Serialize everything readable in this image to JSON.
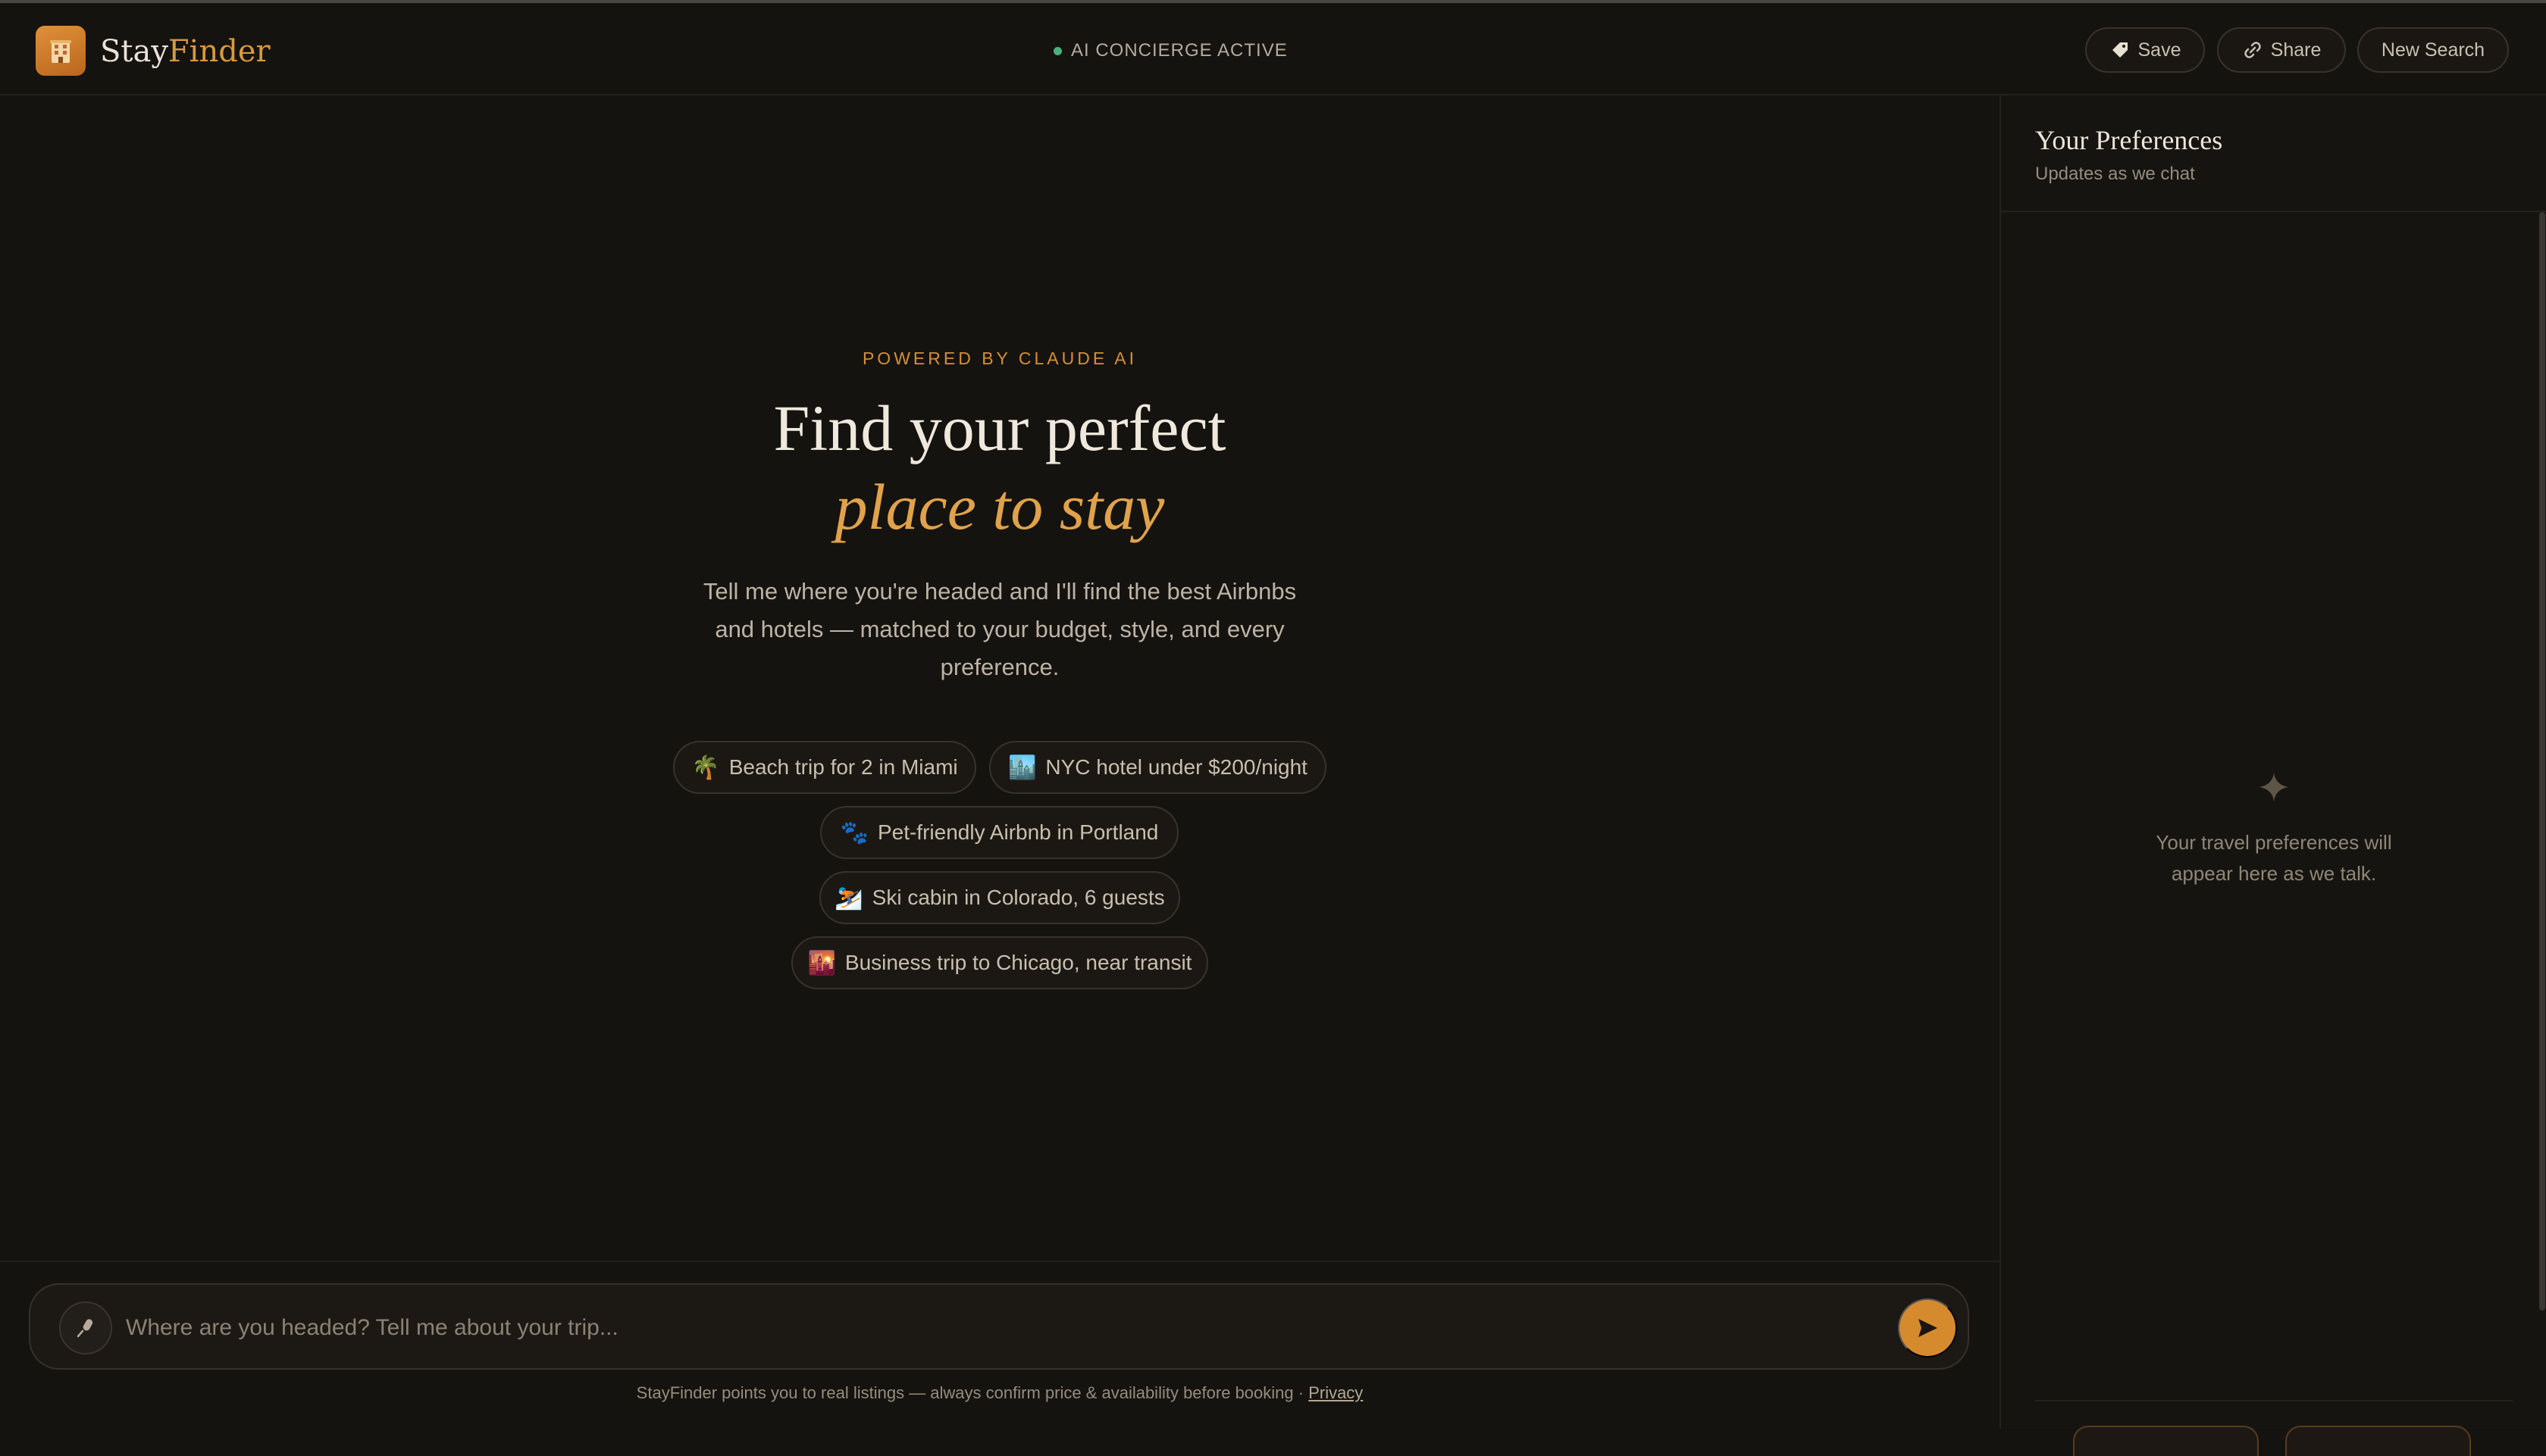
{
  "header": {
    "brand_prefix": "Stay",
    "brand_suffix": "Finder",
    "logo_icon": "hotel-building-icon",
    "status_text": "AI CONCIERGE ACTIVE",
    "status_color": "#49b07a",
    "buttons": {
      "save_label": "Save",
      "share_label": "Share",
      "new_search_label": "New Search"
    }
  },
  "hero": {
    "eyebrow": "POWERED BY CLAUDE AI",
    "title_line1": "Find your perfect",
    "title_line2": "place to stay",
    "subtitle": "Tell me where you're headed and I'll find the best Airbnbs and hotels — matched to your budget, style, and every preference."
  },
  "suggestions": [
    {
      "icon": "🌴",
      "label": "Beach trip for 2 in Miami"
    },
    {
      "icon": "🏙️",
      "label": "NYC hotel under $200/night"
    },
    {
      "icon": "🐾",
      "label": "Pet-friendly Airbnb in Portland"
    },
    {
      "icon": "⛷️",
      "label": "Ski cabin in Colorado, 6 guests"
    },
    {
      "icon": "🌇",
      "label": "Business trip to Chicago, near transit"
    }
  ],
  "composer": {
    "placeholder": "Where are you headed? Tell me about your trip...",
    "value": "",
    "disclaimer": "StayFinder points you to real listings — always confirm price & availability before booking · ",
    "privacy_link": "Privacy"
  },
  "sidebar": {
    "title": "Your Preferences",
    "subtitle": "Updates as we chat",
    "empty_state": "Your travel preferences will appear here as we talk."
  },
  "colors": {
    "accent": "#d99a3c",
    "background": "#151310",
    "send_button": "#d68a2e"
  }
}
